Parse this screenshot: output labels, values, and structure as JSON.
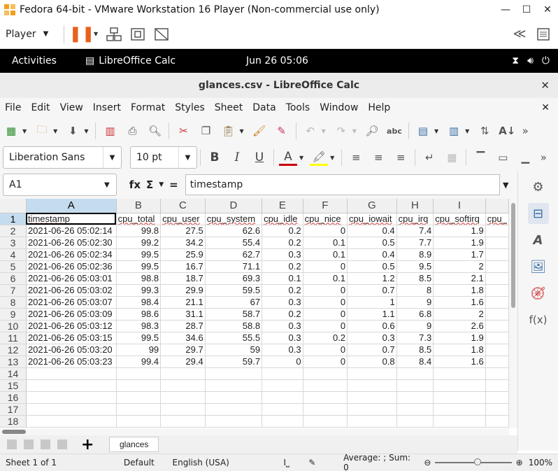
{
  "vm": {
    "title": "Fedora 64-bit - VMware Workstation 16 Player (Non-commercial use only)",
    "player_label": "Player",
    "minimize": "—",
    "maximize": "☐",
    "close": "✕"
  },
  "gnome": {
    "activities": "Activities",
    "app_name": "LibreOffice Calc",
    "clock": "Jun 26  05:06"
  },
  "lo": {
    "window_title": "glances.csv - LibreOffice Calc",
    "close": "✕",
    "menu": [
      "File",
      "Edit",
      "View",
      "Insert",
      "Format",
      "Styles",
      "Sheet",
      "Data",
      "Tools",
      "Window",
      "Help"
    ],
    "font_name": "Liberation Sans",
    "font_size": "10 pt",
    "name_box": "A1",
    "formula_value": "timestamp",
    "fx": "fх",
    "sigma": "Σ",
    "equals": "="
  },
  "grid": {
    "columns": [
      "A",
      "B",
      "C",
      "D",
      "E",
      "F",
      "G",
      "H",
      "I",
      ""
    ],
    "rows": [
      [
        "timestamp",
        "cpu_total",
        "cpu_user",
        "cpu_system",
        "cpu_idle",
        "cpu_nice",
        "cpu_iowait",
        "cpu_irq",
        "cpu_softirq",
        "cpu_"
      ],
      [
        "2021-06-26 05:02:14",
        "99.8",
        "27.5",
        "62.6",
        "0.2",
        "0",
        "0.4",
        "7.4",
        "1.9",
        ""
      ],
      [
        "2021-06-26 05:02:30",
        "99.2",
        "34.2",
        "55.4",
        "0.2",
        "0.1",
        "0.5",
        "7.7",
        "1.9",
        ""
      ],
      [
        "2021-06-26 05:02:34",
        "99.5",
        "25.9",
        "62.7",
        "0.3",
        "0.1",
        "0.4",
        "8.9",
        "1.7",
        ""
      ],
      [
        "2021-06-26 05:02:36",
        "99.5",
        "16.7",
        "71.1",
        "0.2",
        "0",
        "0.5",
        "9.5",
        "2",
        ""
      ],
      [
        "2021-06-26 05:03:01",
        "98.8",
        "18.7",
        "69.3",
        "0.1",
        "0.1",
        "1.2",
        "8.5",
        "2.1",
        ""
      ],
      [
        "2021-06-26 05:03:02",
        "99.3",
        "29.9",
        "59.5",
        "0.2",
        "0",
        "0.7",
        "8",
        "1.8",
        ""
      ],
      [
        "2021-06-26 05:03:07",
        "98.4",
        "21.1",
        "67",
        "0.3",
        "0",
        "1",
        "9",
        "1.6",
        ""
      ],
      [
        "2021-06-26 05:03:09",
        "98.6",
        "31.1",
        "58.7",
        "0.2",
        "0",
        "1.1",
        "6.8",
        "2",
        ""
      ],
      [
        "2021-06-26 05:03:12",
        "98.3",
        "28.7",
        "58.8",
        "0.3",
        "0",
        "0.6",
        "9",
        "2.6",
        ""
      ],
      [
        "2021-06-26 05:03:15",
        "99.5",
        "34.6",
        "55.5",
        "0.3",
        "0.2",
        "0.3",
        "7.3",
        "1.9",
        ""
      ],
      [
        "2021-06-26 05:03:20",
        "99",
        "29.7",
        "59",
        "0.3",
        "0",
        "0.7",
        "8.5",
        "1.8",
        ""
      ],
      [
        "2021-06-26 05:03:23",
        "99.4",
        "29.4",
        "59.7",
        "0",
        "0",
        "0.8",
        "8.4",
        "1.6",
        ""
      ],
      [
        "",
        "",
        "",
        "",
        "",
        "",
        "",
        "",
        "",
        ""
      ],
      [
        "",
        "",
        "",
        "",
        "",
        "",
        "",
        "",
        "",
        ""
      ],
      [
        "",
        "",
        "",
        "",
        "",
        "",
        "",
        "",
        "",
        ""
      ],
      [
        "",
        "",
        "",
        "",
        "",
        "",
        "",
        "",
        "",
        ""
      ],
      [
        "",
        "",
        "",
        "",
        "",
        "",
        "",
        "",
        "",
        ""
      ]
    ]
  },
  "tabs": {
    "add": "+",
    "sheet": "glances"
  },
  "status": {
    "sheet": "Sheet 1 of 1",
    "style": "Default",
    "language": "English (USA)",
    "summary": "Average: ; Sum: 0",
    "zoom": "100%"
  }
}
